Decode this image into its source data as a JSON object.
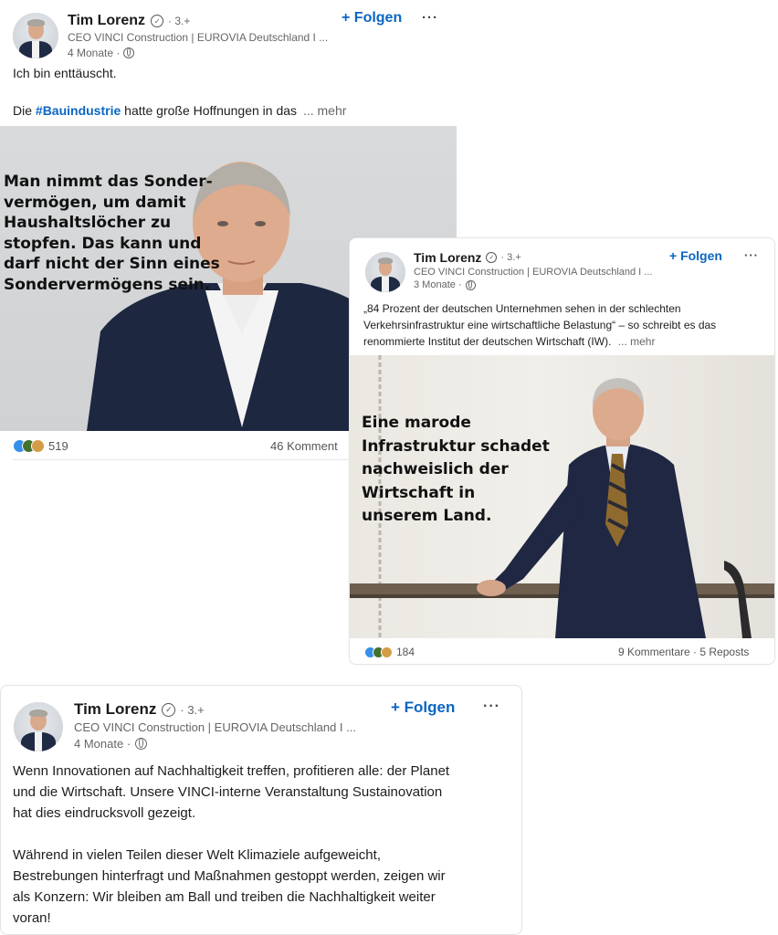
{
  "post1": {
    "author": "Tim Lorenz",
    "degree": "· 3.+",
    "headline": "CEO VINCI Construction | EUROVIA Deutschland I ...",
    "time": "4 Monate ·",
    "follow": "+ Folgen",
    "more": "···",
    "text_line1": "Ich bin enttäuscht.",
    "text_pre": "Die",
    "hashtag": "#Bauindustrie",
    "text_post": "hatte große Hoffnungen in das",
    "see_more": "... mehr",
    "image_quote": [
      "Man nimmt das Sonder-",
      "vermögen, um damit",
      "Haushaltslöcher zu",
      "stopfen. Das kann und",
      "darf nicht der Sinn eines",
      "Sondervermögens sein."
    ],
    "reactions": "519",
    "comments": "46 Komment"
  },
  "post2": {
    "author": "Tim Lorenz",
    "degree": "· 3.+",
    "headline": "CEO VINCI Construction | EUROVIA Deutschland I ...",
    "time": "3 Monate ·",
    "follow": "+ Folgen",
    "more": "···",
    "text_line1": "„84 Prozent der deutschen Unternehmen sehen in der schlechten",
    "text_line2": "Verkehrsinfrastruktur eine wirtschaftliche Belastung“ – so schreibt es das",
    "text_line3": "renommierte Institut der deutschen Wirtschaft (IW).",
    "see_more": "... mehr",
    "image_quote": [
      "Eine marode",
      "Infrastruktur schadet",
      "nachweislich der",
      "Wirtschaft in",
      "unserem Land."
    ],
    "reactions": "184",
    "counts": "9 Kommentare · 5 Reposts"
  },
  "post3": {
    "author": "Tim Lorenz",
    "degree": "· 3.+",
    "headline": "CEO VINCI Construction | EUROVIA Deutschland I ...",
    "time": "4 Monate ·",
    "follow": "+ Folgen",
    "more": "···",
    "para1": [
      "Wenn Innovationen auf Nachhaltigkeit treffen, profitieren alle: der Planet",
      "und die Wirtschaft. Unsere VINCI-interne Veranstaltung Sustainovation",
      "hat dies eindrucksvoll gezeigt."
    ],
    "para2": [
      "Während in vielen Teilen dieser Welt Klimaziele aufgeweicht,",
      "Bestrebungen hinterfragt und Maßnahmen gestoppt werden, zeigen wir",
      "als Konzern: Wir bleiben am Ball und treiben die Nachhaltigkeit weiter",
      "voran!"
    ]
  },
  "colors": {
    "link": "#0a66c2",
    "text": "#1d1d1d",
    "muted": "#666666",
    "like": "#378fe9",
    "celebrate": "#44712e",
    "support": "#d39c46"
  },
  "icons": [
    "verified-shield-icon",
    "globe-icon",
    "more-options-icon",
    "like-reaction-icon",
    "celebrate-reaction-icon",
    "insightful-reaction-icon"
  ]
}
